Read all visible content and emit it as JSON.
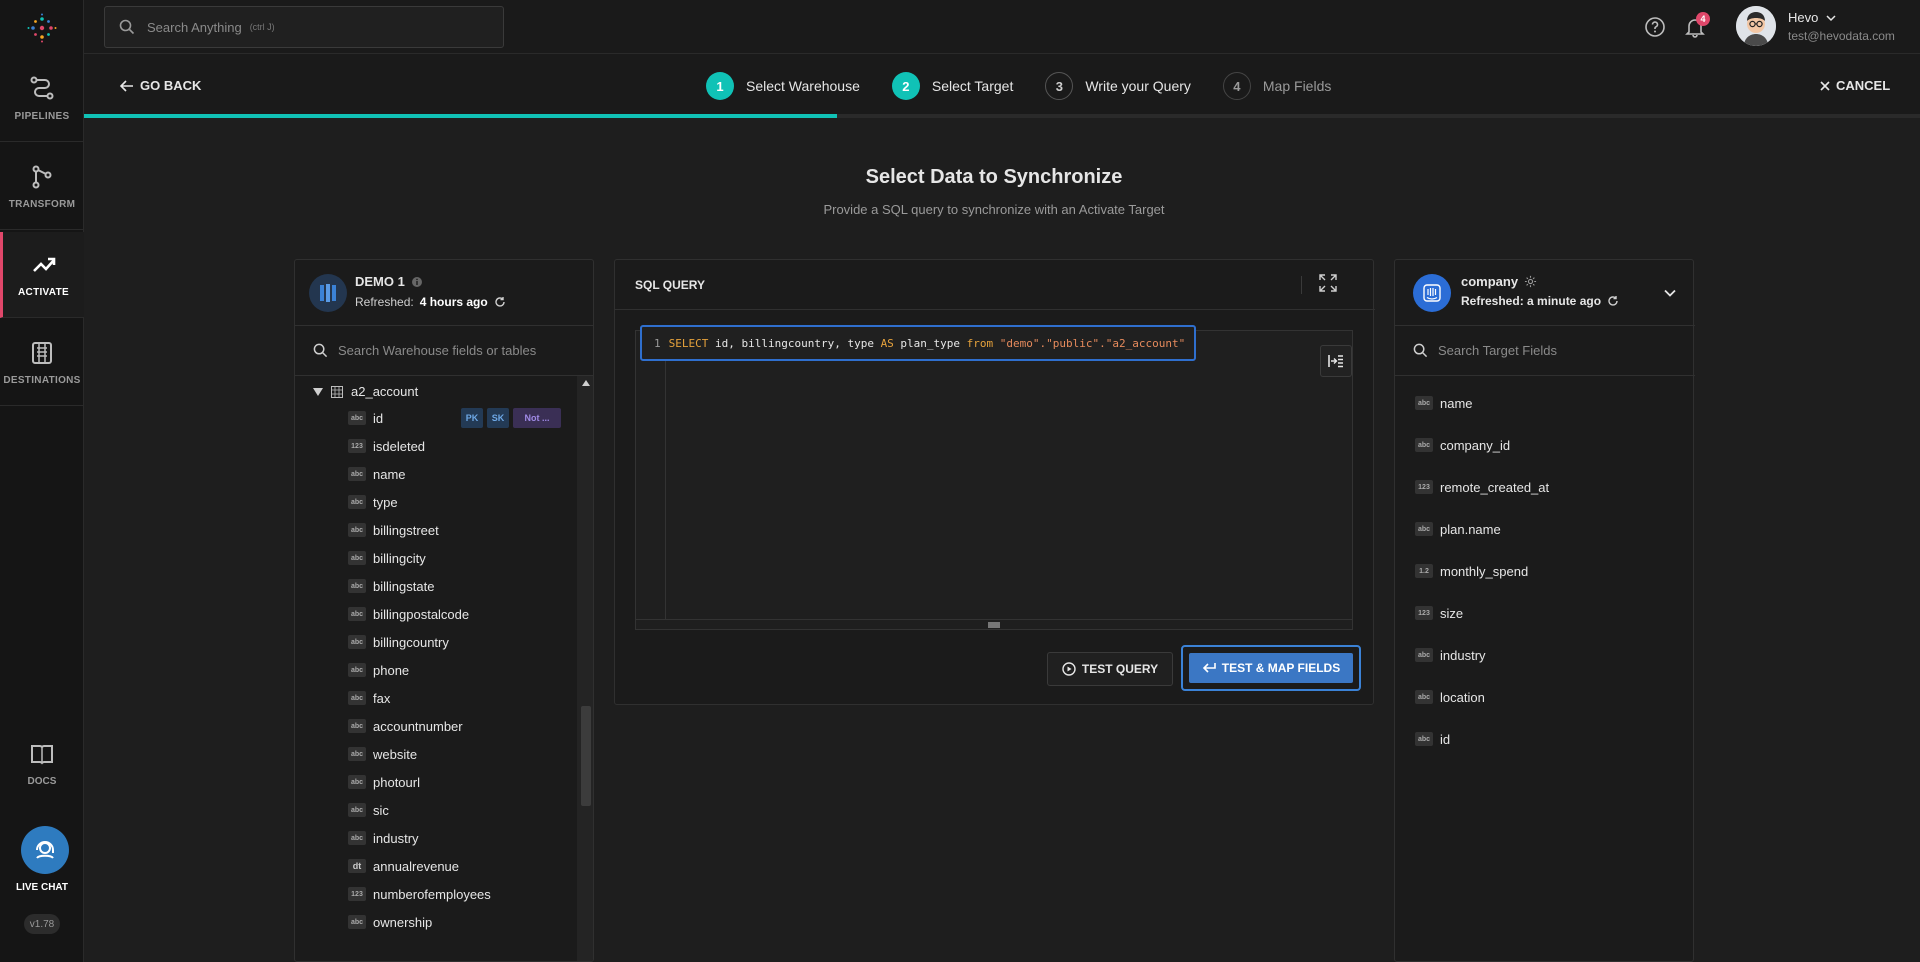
{
  "sidebar": {
    "items": [
      {
        "label": "PIPELINES",
        "icon": "pipelines-icon"
      },
      {
        "label": "TRANSFORM",
        "icon": "transform-icon"
      },
      {
        "label": "ACTIVATE",
        "icon": "activate-icon",
        "active": true
      },
      {
        "label": "DESTINATIONS",
        "icon": "destinations-icon"
      }
    ],
    "docs_label": "DOCS",
    "live_chat_label": "LIVE CHAT",
    "version": "v1.78"
  },
  "topbar": {
    "search_placeholder": "Search Anything",
    "search_hint": "(ctrl J)",
    "notification_count": "4",
    "user_name": "Hevo",
    "user_email": "test@hevodata.com"
  },
  "stepper": {
    "go_back": "GO BACK",
    "cancel": "CANCEL",
    "progress_percent": 41,
    "steps": [
      {
        "num": "1",
        "label": "Select Warehouse",
        "state": "done"
      },
      {
        "num": "2",
        "label": "Select Target",
        "state": "done"
      },
      {
        "num": "3",
        "label": "Write your Query",
        "state": "current"
      },
      {
        "num": "4",
        "label": "Map Fields",
        "state": "todo"
      }
    ]
  },
  "page": {
    "title": "Select Data to Synchronize",
    "subtitle": "Provide a SQL query to synchronize with an Activate Target"
  },
  "warehouse": {
    "name": "DEMO 1",
    "refreshed_prefix": "Refreshed:",
    "refreshed_value": "4 hours ago",
    "search_placeholder": "Search Warehouse fields or tables",
    "table": "a2_account",
    "tags": {
      "pk": "PK",
      "sk": "SK",
      "nn": "Not ..."
    },
    "fields": [
      {
        "type": "abc",
        "name": "id"
      },
      {
        "type": "123",
        "name": "isdeleted"
      },
      {
        "type": "abc",
        "name": "name"
      },
      {
        "type": "abc",
        "name": "type"
      },
      {
        "type": "abc",
        "name": "billingstreet"
      },
      {
        "type": "abc",
        "name": "billingcity"
      },
      {
        "type": "abc",
        "name": "billingstate"
      },
      {
        "type": "abc",
        "name": "billingpostalcode"
      },
      {
        "type": "abc",
        "name": "billingcountry"
      },
      {
        "type": "abc",
        "name": "phone"
      },
      {
        "type": "abc",
        "name": "fax"
      },
      {
        "type": "abc",
        "name": "accountnumber"
      },
      {
        "type": "abc",
        "name": "website"
      },
      {
        "type": "abc",
        "name": "photourl"
      },
      {
        "type": "abc",
        "name": "sic"
      },
      {
        "type": "abc",
        "name": "industry"
      },
      {
        "type": "dt",
        "name": "annualrevenue"
      },
      {
        "type": "123",
        "name": "numberofemployees"
      },
      {
        "type": "abc",
        "name": "ownership"
      }
    ]
  },
  "sql": {
    "title": "SQL QUERY",
    "line_number": "1",
    "query_tokens": [
      {
        "t": "SELECT",
        "c": "kw"
      },
      {
        "t": " id, billingcountry, type ",
        "c": "plain"
      },
      {
        "t": "AS",
        "c": "kw"
      },
      {
        "t": " plan_type ",
        "c": "plain"
      },
      {
        "t": "from",
        "c": "kw"
      },
      {
        "t": " ",
        "c": "plain"
      },
      {
        "t": "\"demo\".\"public\".\"a2_account\"",
        "c": "str"
      }
    ],
    "test_query_label": "TEST QUERY",
    "test_map_label": "TEST & MAP FIELDS"
  },
  "target": {
    "name": "company",
    "refreshed": "Refreshed: a minute ago",
    "search_placeholder": "Search Target Fields",
    "fields": [
      {
        "type": "abc",
        "name": "name"
      },
      {
        "type": "abc",
        "name": "company_id"
      },
      {
        "type": "123",
        "name": "remote_created_at"
      },
      {
        "type": "abc",
        "name": "plan.name"
      },
      {
        "type": "1.2",
        "name": "monthly_spend"
      },
      {
        "type": "123",
        "name": "size"
      },
      {
        "type": "abc",
        "name": "industry"
      },
      {
        "type": "abc",
        "name": "location"
      },
      {
        "type": "abc",
        "name": "id"
      }
    ]
  },
  "colors": {
    "accent": "#10c2b6",
    "primary_button": "#3b77c4",
    "active_marker": "#e0476a"
  }
}
